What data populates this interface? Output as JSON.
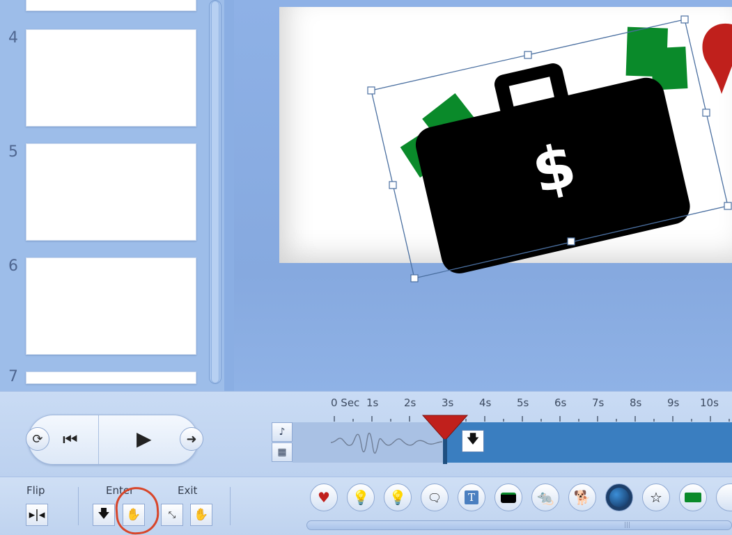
{
  "slides": {
    "numbers": [
      "4",
      "5",
      "6",
      "7"
    ]
  },
  "timeline": {
    "ticks": [
      "0 Sec",
      "1s",
      "2s",
      "3s",
      "4s",
      "5s",
      "6s",
      "7s",
      "8s",
      "9s",
      "10s"
    ]
  },
  "toolbar": {
    "flip_label": "Flip",
    "enter_label": "Enter",
    "exit_label": "Exit"
  },
  "slide_content": {
    "dollar": "$"
  },
  "colors": {
    "accent_red": "#c0201c",
    "money_green": "#0a8a2a",
    "timeline_blue": "#3a7ec0"
  },
  "icons": {
    "palette": [
      "heart-icon",
      "lightbulb-icon",
      "lightbulb-outline-icon",
      "speech-bubble-icon",
      "text-box-icon",
      "briefcase-icon",
      "rat-icon",
      "dog-icon",
      "globe-icon",
      "star-icon",
      "money-icon"
    ]
  }
}
